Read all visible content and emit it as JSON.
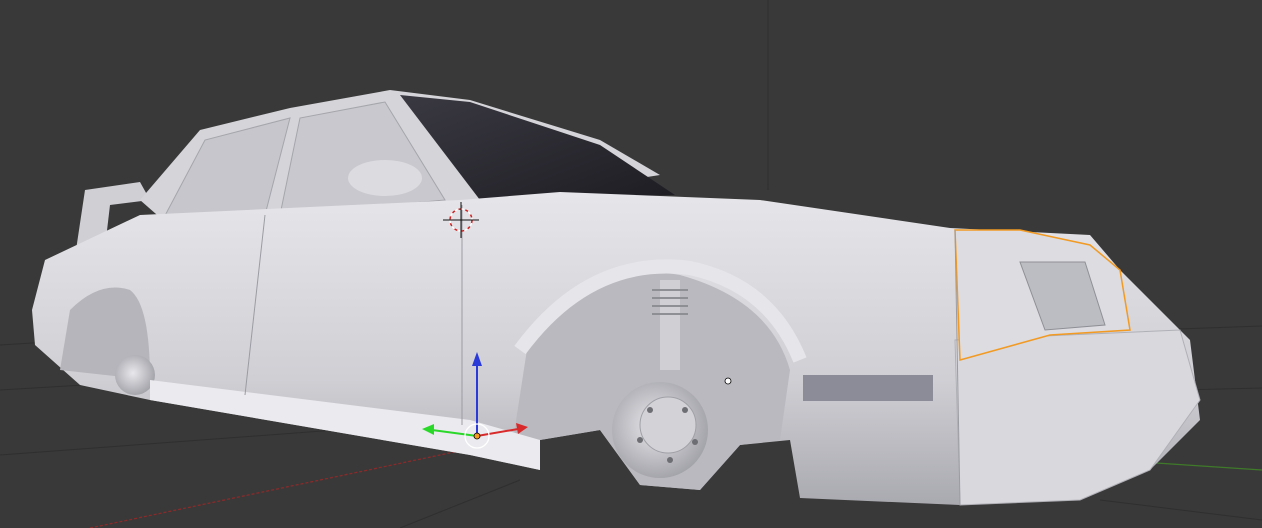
{
  "viewport": {
    "mode": "3d-viewport",
    "background_color": "#393939",
    "grid_color": "#2f2f2f",
    "x_axis_color": "#8a2a2a",
    "y_axis_color": "#3f7a2a",
    "model_color": "#d9d9de",
    "glass_color": "#26252c",
    "selection_color": "#f29a22"
  },
  "icons": {
    "cursor": "3d-cursor-icon",
    "gizmo": "transform-gizmo-icon"
  }
}
